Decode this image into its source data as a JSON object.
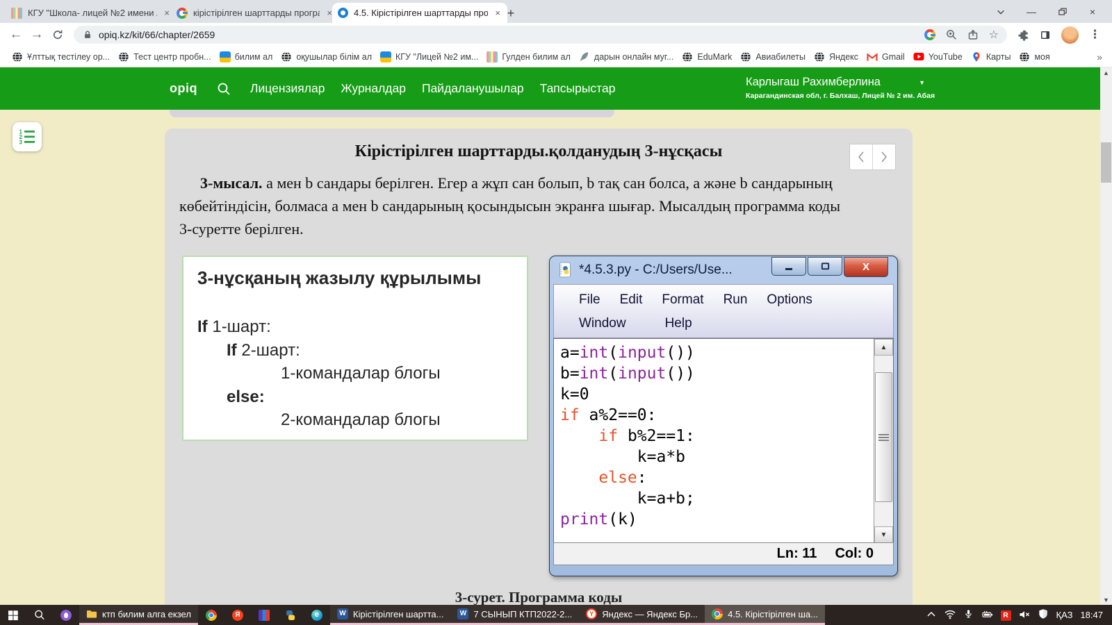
{
  "theme": {
    "header_green": "#169c16",
    "page_beige": "#f1ebc6",
    "card_gray": "#dcdcdc",
    "taskbar_dark": "#2a2320",
    "keyword_orange": "#e5532a",
    "builtin_purple": "#8b249c"
  },
  "browser": {
    "tabs": [
      {
        "label": "КГУ \"Школа- лицей №2 имени А",
        "icon": "school"
      },
      {
        "label": "кірістірілген шарттарды програ",
        "icon": "google-g"
      },
      {
        "label": "4.5. Кірістірілген шарттарды про",
        "icon": "opiq",
        "active": true
      }
    ],
    "new_tab": "+",
    "url": "opiq.kz/kit/66/chapter/2659",
    "bookmarks": [
      {
        "label": "Ұлттық тестілеу ор...",
        "icon": "globe"
      },
      {
        "label": "Тест центр пробн...",
        "icon": "globe"
      },
      {
        "label": "билим ал",
        "icon": "flag"
      },
      {
        "label": "оқушылар білім ал",
        "icon": "globe"
      },
      {
        "label": "КГУ \"Лицей №2 им...",
        "icon": "flag"
      },
      {
        "label": "Гулден билим ал",
        "icon": "stripes"
      },
      {
        "label": "дарын онлайн муг...",
        "icon": "feather"
      },
      {
        "label": "EduMark",
        "icon": "globe"
      },
      {
        "label": "Авиабилеты",
        "icon": "globe"
      },
      {
        "label": "Яндекс",
        "icon": "globe"
      },
      {
        "label": "Gmail",
        "icon": "gmail"
      },
      {
        "label": "YouTube",
        "icon": "youtube"
      },
      {
        "label": "Карты",
        "icon": "maps"
      },
      {
        "label": "моя",
        "icon": "globe"
      }
    ],
    "overflow_chevron": "»"
  },
  "header": {
    "logo": "opiq",
    "nav": [
      "Лицензиялар",
      "Журналдар",
      "Пайдаланушылар",
      "Тапсырыстар"
    ],
    "user": {
      "name": "Карлыгаш Рахимберлина",
      "org": "Карагандинская обл, г. Балхаш, Лицей № 2 им. Абая"
    }
  },
  "lesson": {
    "title": "Кірістірілген шарттарды.қолданудың 3-нұсқасы",
    "para": {
      "lead": "3-мысал.",
      "l1": " a мен b сандары берілген. Егер a жұп сан болып, b тақ сан болса, a және b сандарының",
      "l2": "көбейтіндісін, болмаса a мен b сандарының қосындысын экранға шығар. Мысалдың программа коды",
      "l3": "3-суретте берілген."
    },
    "caption": "3-сурет. Программа коды"
  },
  "structure_panel": {
    "title": "3-нұсқаның жазылу құрылымы",
    "lines": [
      {
        "indent": 0,
        "bold": "If",
        "text": "  1-шарт:"
      },
      {
        "indent": 1,
        "bold": "If",
        "text": "  2-шарт:"
      },
      {
        "indent": 2,
        "bold": "",
        "text": "1-командалар блогы"
      },
      {
        "indent": 1,
        "bold": "else:",
        "text": ""
      },
      {
        "indent": 2,
        "bold": "",
        "text": "2-командалар блогы"
      }
    ]
  },
  "idle": {
    "title": "*4.5.3.py - C:/Users/Use...",
    "menus": [
      [
        "File",
        "Edit",
        "Format",
        "Run",
        "Options"
      ],
      [
        "Window",
        "Help"
      ]
    ],
    "code": [
      [
        {
          "t": "a=",
          "c": "n"
        },
        {
          "t": "int",
          "c": "b"
        },
        {
          "t": "(",
          "c": "n"
        },
        {
          "t": "input",
          "c": "b"
        },
        {
          "t": "())",
          "c": "n"
        }
      ],
      [
        {
          "t": "b=",
          "c": "n"
        },
        {
          "t": "int",
          "c": "b"
        },
        {
          "t": "(",
          "c": "n"
        },
        {
          "t": "input",
          "c": "b"
        },
        {
          "t": "())",
          "c": "n"
        }
      ],
      [
        {
          "t": "k=0",
          "c": "n"
        }
      ],
      [
        {
          "t": "if",
          "c": "k"
        },
        {
          "t": " a%2==0:",
          "c": "n"
        }
      ],
      [
        {
          "t": "    ",
          "c": "n"
        },
        {
          "t": "if",
          "c": "k"
        },
        {
          "t": " b%2==1:",
          "c": "n"
        }
      ],
      [
        {
          "t": "        k=a*b",
          "c": "n"
        }
      ],
      [
        {
          "t": "    ",
          "c": "n"
        },
        {
          "t": "else",
          "c": "k"
        },
        {
          "t": ":",
          "c": "n"
        }
      ],
      [
        {
          "t": "        k=a+b;",
          "c": "n"
        }
      ],
      [
        {
          "t": "print",
          "c": "b"
        },
        {
          "t": "(k)",
          "c": "n"
        }
      ]
    ],
    "status": {
      "ln": "Ln: 11",
      "col": "Col: 0"
    }
  },
  "taskbar": {
    "items": [
      {
        "icon": "start"
      },
      {
        "icon": "taskbar-search"
      },
      {
        "icon": "purple-app"
      },
      {
        "icon": "folder",
        "label": "ктп билим алга екзел",
        "open": true
      },
      {
        "icon": "chrome"
      },
      {
        "icon": "yandex"
      },
      {
        "icon": "winrar"
      },
      {
        "icon": "python"
      },
      {
        "icon": "edge"
      },
      {
        "icon": "word",
        "label": "Кірістірілген шартта...",
        "open": true
      },
      {
        "icon": "word",
        "label": "7 СЫНЫП КТП2022-2...",
        "open": true
      },
      {
        "icon": "yandex-browser",
        "label": "Яндекс — Яндекс Бр...",
        "open": true
      },
      {
        "icon": "chrome",
        "label": "4.5. Кірістірілген ша...",
        "open": true,
        "active": true
      }
    ],
    "tray": {
      "icons": [
        "chevron-up",
        "wifi",
        "microphone",
        "battery",
        "antivirus-r",
        "volume-muted",
        "shield"
      ],
      "lang": "ҚАЗ",
      "time": "18:47"
    }
  }
}
